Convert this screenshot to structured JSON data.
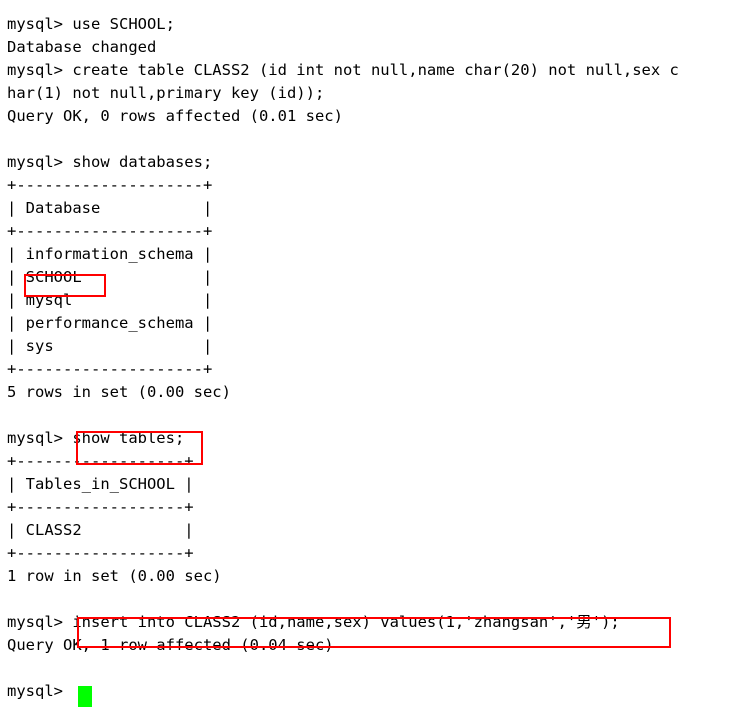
{
  "terminal": {
    "prompt": "mysql>",
    "background_color": "#ffffff",
    "text_color": "#000000",
    "cursor_color": "#00ff00",
    "annotation_color": "#ff0000",
    "lines": [
      "mysql> use SCHOOL;",
      "Database changed",
      "mysql> create table CLASS2 (id int not null,name char(20) not null,sex c",
      "har(1) not null,primary key (id));",
      "Query OK, 0 rows affected (0.01 sec)",
      "",
      "mysql> show databases;",
      "+--------------------+",
      "| Database           |",
      "+--------------------+",
      "| information_schema |",
      "| SCHOOL             |",
      "| mysql              |",
      "| performance_schema |",
      "| sys                |",
      "+--------------------+",
      "5 rows in set (0.00 sec)",
      "",
      "mysql> show tables;",
      "+------------------+",
      "| Tables_in_SCHOOL |",
      "+------------------+",
      "| CLASS2           |",
      "+------------------+",
      "1 row in set (0.00 sec)",
      "",
      "mysql> insert into CLASS2 (id,name,sex) values(1,'zhangsan','男');",
      "Query OK, 1 row affected (0.04 sec)",
      "",
      "mysql> "
    ]
  },
  "annotations": [
    {
      "name": "school-database-highlight",
      "target_text": "SCHOOL"
    },
    {
      "name": "show-tables-command-highlight",
      "target_text": "show tables;"
    },
    {
      "name": "insert-statement-highlight",
      "target_text": "insert into CLASS2 (id,name,sex) values(1,'zhangsan','男');"
    }
  ]
}
